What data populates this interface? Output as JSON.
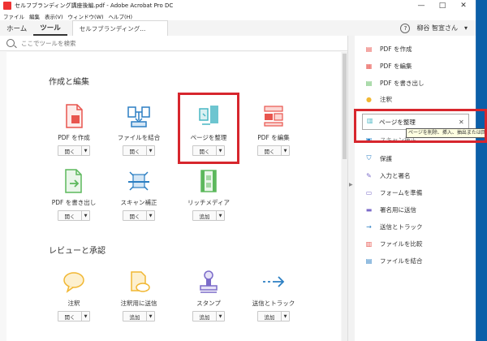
{
  "window": {
    "title": "セルフブランディング講座後編.pdf - Adobe Acrobat Pro DC",
    "controls": [
      "—",
      "□",
      "✕"
    ]
  },
  "menu": [
    "ファイル",
    "編集",
    "表示(V)",
    "ウィンドウ(W)",
    "ヘルプ(H)"
  ],
  "tabs": {
    "home": "ホーム",
    "tools": "ツール",
    "document": "セルフブランディング...",
    "help_icon_label": "?",
    "user": "柳谷 智宣さん",
    "user_caret": "▾"
  },
  "search": {
    "placeholder": "ここでツールを検索"
  },
  "sections": {
    "create_edit": "作成と編集",
    "review": "レビューと承認"
  },
  "tools_row1": [
    {
      "label": "PDF を作成",
      "button": "開く"
    },
    {
      "label": "ファイルを結合",
      "button": "開く"
    },
    {
      "label": "ページを整理",
      "button": "開く"
    },
    {
      "label": "PDF を編集",
      "button": "開く"
    }
  ],
  "tools_row2": [
    {
      "label": "PDF を書き出し",
      "button": "開く"
    },
    {
      "label": "スキャン補正",
      "button": "開く"
    },
    {
      "label": "リッチメディア",
      "button": "追加"
    }
  ],
  "tools_row3": [
    {
      "label": "注釈",
      "button": "開く"
    },
    {
      "label": "注釈用に送信",
      "button": "追加"
    },
    {
      "label": "スタンプ",
      "button": "追加"
    },
    {
      "label": "送信とトラック",
      "button": "追加"
    }
  ],
  "right_panel": {
    "items_top": [
      "PDF を作成",
      "PDF を編集",
      "PDF を書き出し",
      "注釈"
    ],
    "items_bottom": [
      "保護",
      "入力と署名",
      "フォームを準備",
      "署名用に送信",
      "送信とトラック",
      "ファイルを比較",
      "ファイルを結合"
    ],
    "partial_item": "スキャン補正",
    "search_value": "ページを整理",
    "search_clear": "✕",
    "tooltip": "ページを削除、挿入、抽出または回転"
  },
  "colors": {
    "accent_red": "#d7262d",
    "pdf_red": "#e8554e",
    "teal": "#49b7c4",
    "blue": "#2c7fc3",
    "purple": "#7b6bc9",
    "yellow": "#f1b733",
    "green": "#5cb85c"
  }
}
